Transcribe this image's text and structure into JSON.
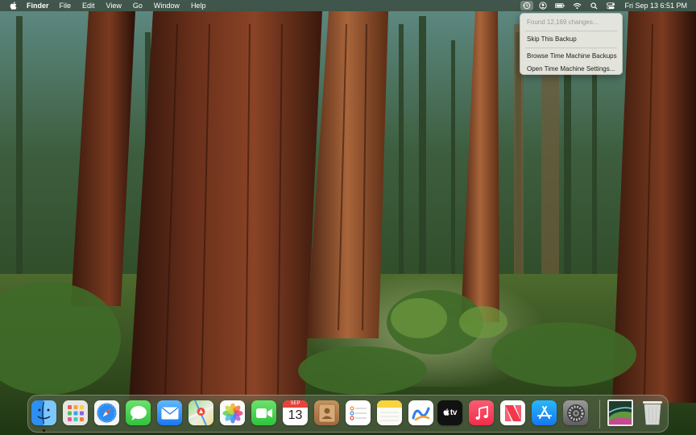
{
  "menubar": {
    "app_name": "Finder",
    "items": [
      "File",
      "Edit",
      "View",
      "Go",
      "Window",
      "Help"
    ],
    "clock": "Fri Sep 13  6:51 PM"
  },
  "dropdown": {
    "status": "Found 12,169 changes...",
    "skip_backup": "Skip This Backup",
    "browse_backups": "Browse Time Machine Backups",
    "open_settings": "Open Time Machine Settings..."
  },
  "dock": {
    "calendar": {
      "month": "SEP",
      "day": "13"
    },
    "tv_label": "tv",
    "apps": [
      "finder-icon",
      "launchpad-icon",
      "safari-icon",
      "messages-icon",
      "mail-icon",
      "maps-icon",
      "photos-icon",
      "facetime-icon",
      "calendar-icon",
      "contacts-icon",
      "reminders-icon",
      "notes-icon",
      "freeform-icon",
      "apple-tv-icon",
      "music-icon",
      "news-icon",
      "app-store-icon",
      "system-settings-icon",
      "preview-thumbnail-icon",
      "trash-icon"
    ]
  },
  "colors": {
    "menubar": "#282c1e",
    "dropdown_bg": "#eeece4",
    "calendar_red": "#e8423b"
  }
}
